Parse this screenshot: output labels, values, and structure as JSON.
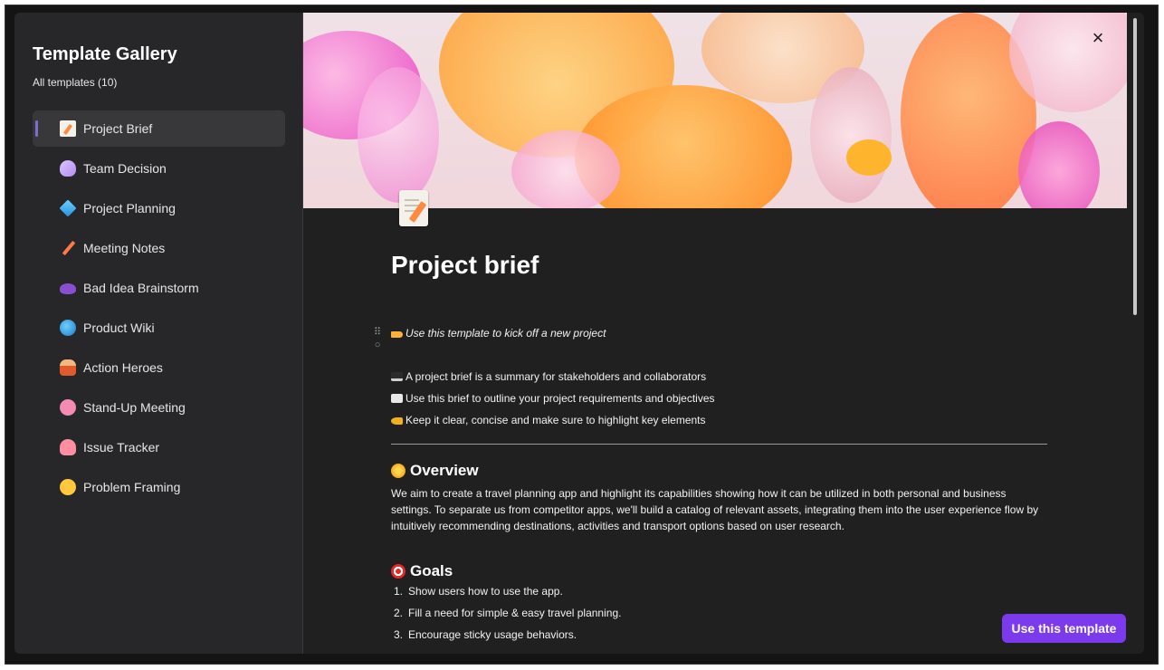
{
  "sidebar": {
    "title": "Template Gallery",
    "subtitle": "All templates (10)",
    "items": [
      {
        "label": "Project Brief",
        "icon": "memo-icon",
        "active": true
      },
      {
        "label": "Team Decision",
        "icon": "unicorn-icon"
      },
      {
        "label": "Project Planning",
        "icon": "gem-icon"
      },
      {
        "label": "Meeting Notes",
        "icon": "pencil-icon"
      },
      {
        "label": "Bad Idea Brainstorm",
        "icon": "storm-cloud-icon"
      },
      {
        "label": "Product Wiki",
        "icon": "globe-icon"
      },
      {
        "label": "Action Heroes",
        "icon": "superhero-icon"
      },
      {
        "label": "Stand-Up Meeting",
        "icon": "brain-icon"
      },
      {
        "label": "Issue Tracker",
        "icon": "octopus-icon"
      },
      {
        "label": "Problem Framing",
        "icon": "thinking-face-icon"
      }
    ]
  },
  "preview": {
    "title": "Project brief",
    "intro": "Use this template to kick off a new project",
    "bullets": [
      "A project brief is a summary for stakeholders and collaborators",
      "Use this brief to outline your project requirements and objectives",
      "Keep it clear, concise and make sure to highlight key elements"
    ],
    "overview_heading": "Overview",
    "overview_text": "We aim to create a travel planning app and highlight its capabilities showing how it can be utilized in both personal and business settings. To separate us from competitor apps, we'll build a catalog of relevant assets, integrating them into the user experience flow by intuitively recommending destinations, activities and transport options based on user research.",
    "goals_heading": "Goals",
    "goals": [
      {
        "num": "1.",
        "text": "Show users how to use the app."
      },
      {
        "num": "2.",
        "text": "Fill a need for simple & easy travel planning."
      },
      {
        "num": "3.",
        "text": "Encourage sticky usage behaviors."
      }
    ]
  },
  "actions": {
    "use_template": "Use this template",
    "close": "×"
  },
  "colors": {
    "accent": "#7c3aed",
    "sidebar_bg": "#272729",
    "content_bg": "#202020"
  }
}
